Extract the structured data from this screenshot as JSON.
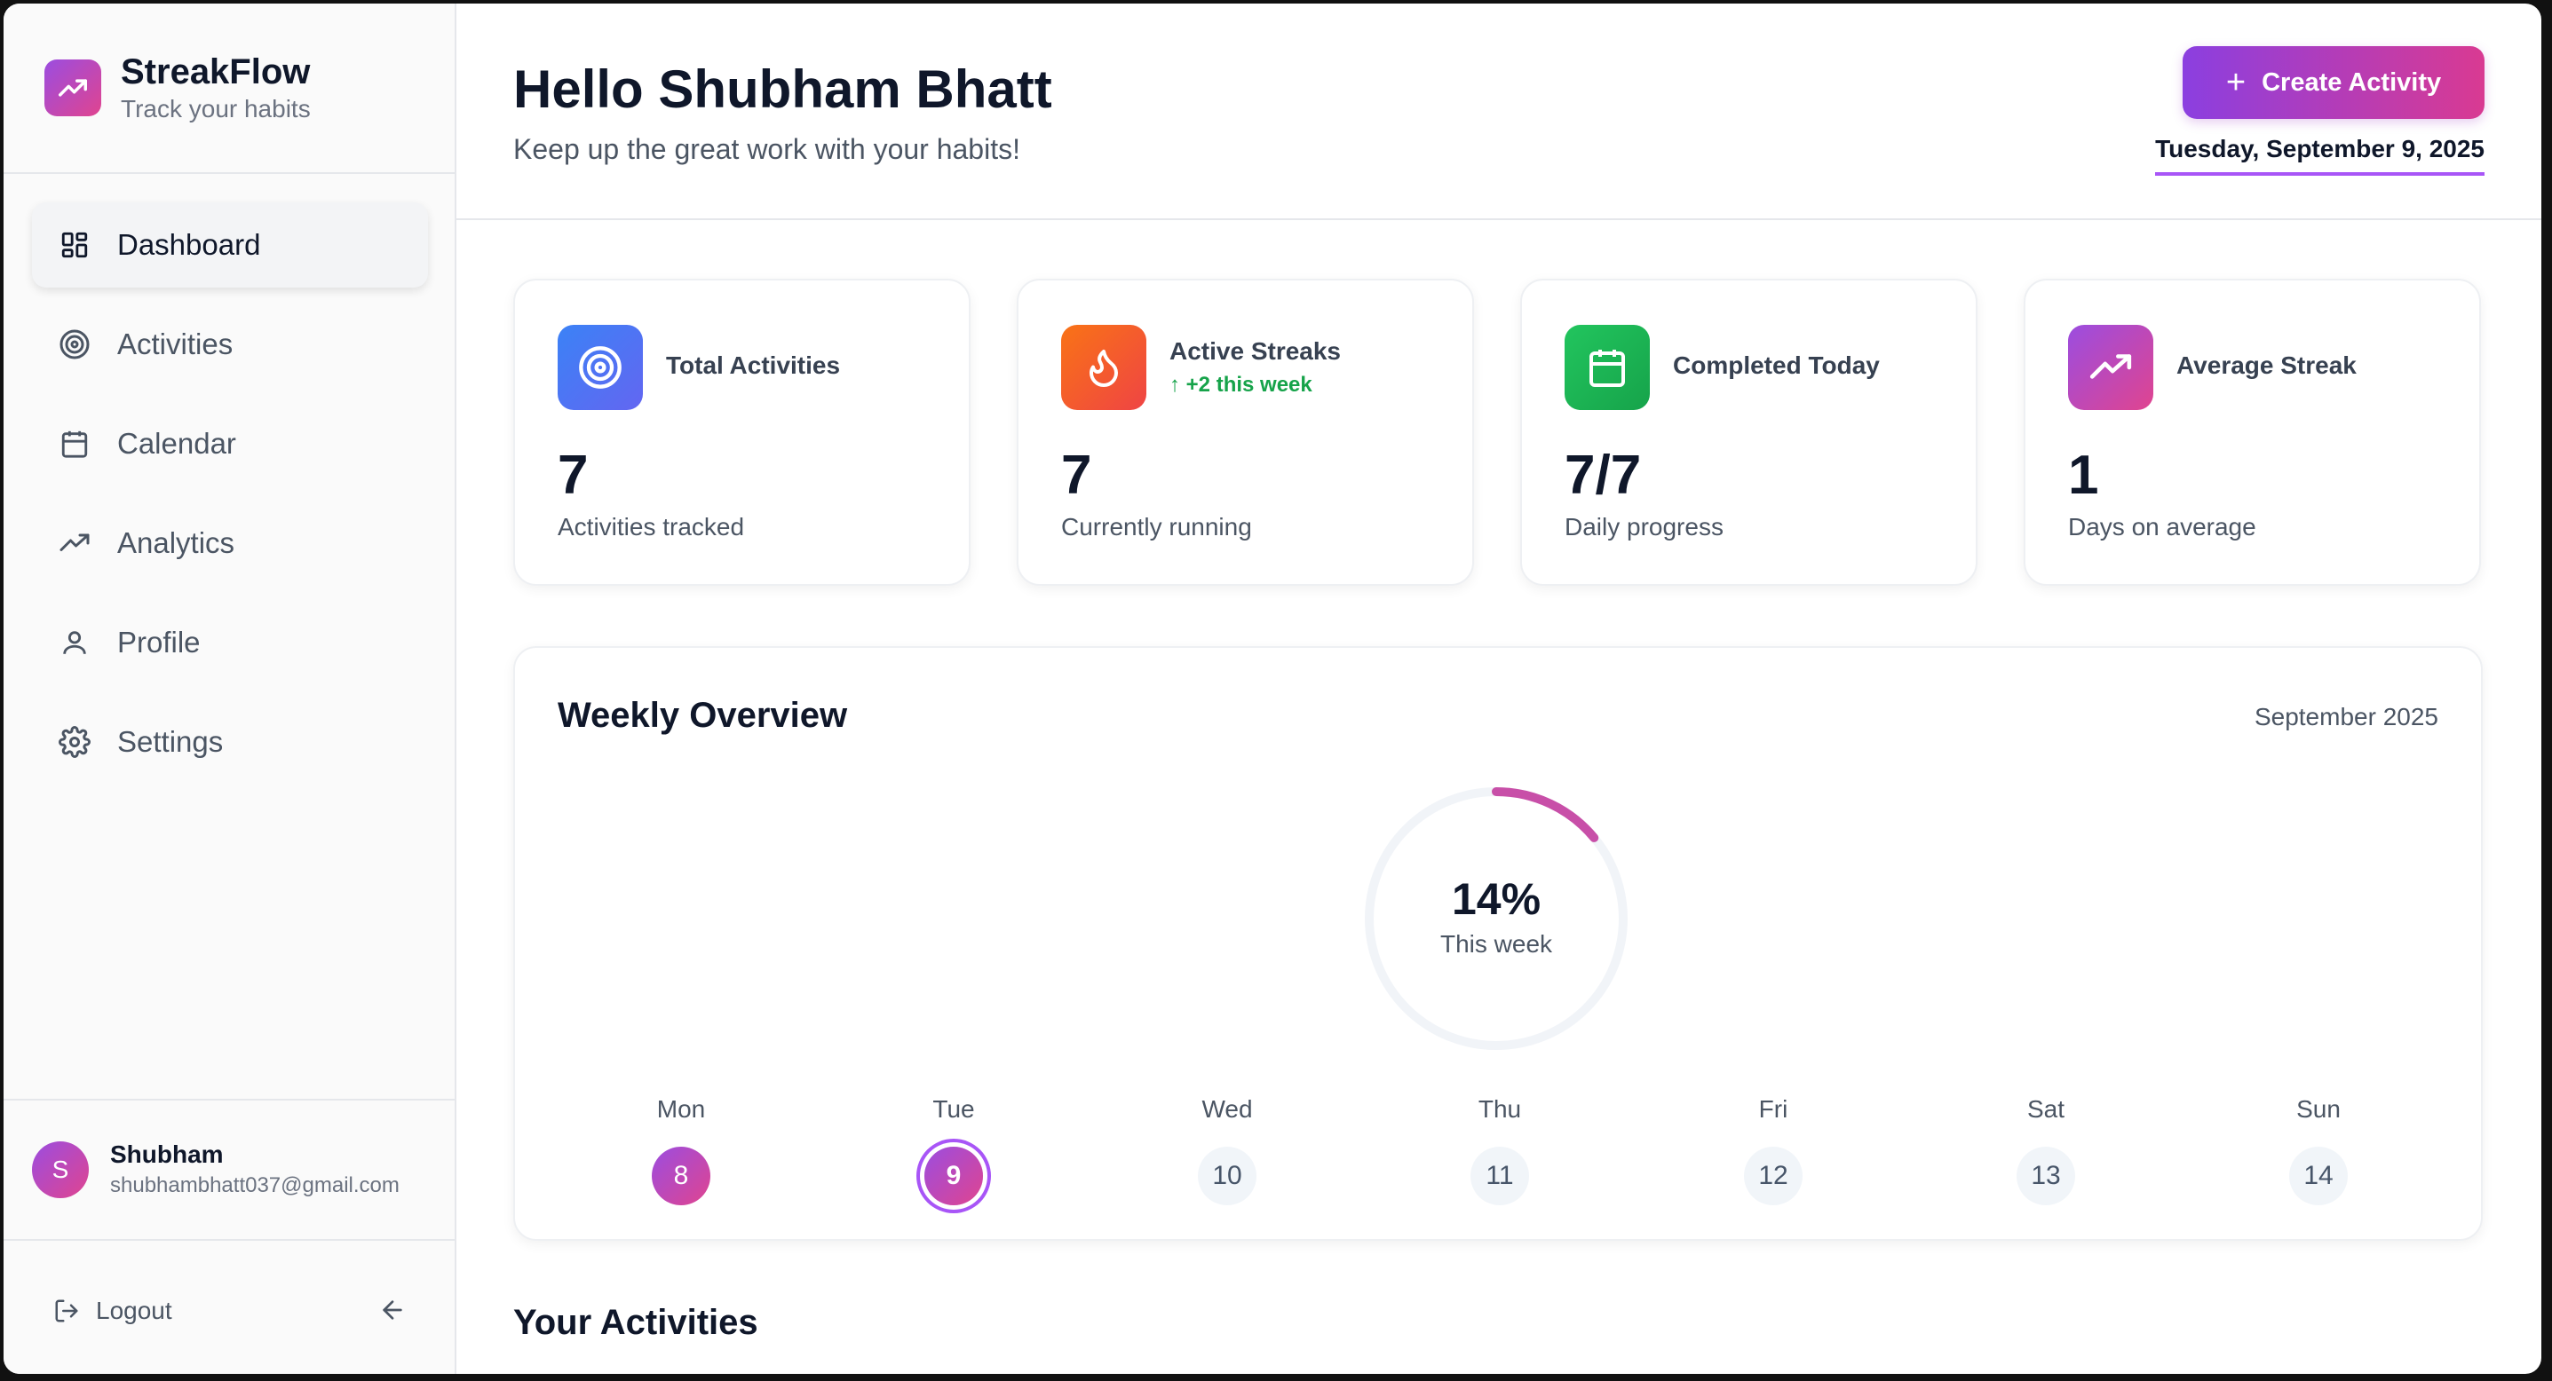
{
  "brand": {
    "title": "StreakFlow",
    "subtitle": "Track your habits"
  },
  "nav": {
    "items": [
      {
        "label": "Dashboard",
        "icon": "dashboard-icon",
        "active": true
      },
      {
        "label": "Activities",
        "icon": "target-icon"
      },
      {
        "label": "Calendar",
        "icon": "calendar-icon"
      },
      {
        "label": "Analytics",
        "icon": "trending-up-icon"
      },
      {
        "label": "Profile",
        "icon": "user-icon"
      },
      {
        "label": "Settings",
        "icon": "gear-icon"
      }
    ]
  },
  "user": {
    "initial": "S",
    "name": "Shubham",
    "email": "shubhambhatt037@gmail.com"
  },
  "logout": {
    "label": "Logout"
  },
  "header": {
    "greeting": "Hello Shubham Bhatt",
    "subtitle": "Keep up the great work with your habits!",
    "create_label": "Create Activity",
    "date": "Tuesday, September 9, 2025"
  },
  "stats": [
    {
      "title": "Total Activities",
      "value": "7",
      "desc": "Activities tracked",
      "icon": "target-icon",
      "color": "#3b82f6"
    },
    {
      "title": "Active Streaks",
      "trend": "↑ +2 this week",
      "value": "7",
      "desc": "Currently running",
      "icon": "flame-icon",
      "color": "#f97316"
    },
    {
      "title": "Completed Today",
      "value": "7/7",
      "desc": "Daily progress",
      "icon": "calendar-icon",
      "color": "#22c55e"
    },
    {
      "title": "Average Streak",
      "value": "1",
      "desc": "Days on average",
      "icon": "trending-up-icon",
      "color": "#a855f7"
    }
  ],
  "weekly": {
    "title": "Weekly Overview",
    "month": "September 2025",
    "percent_label": "14%",
    "percent_value": 14,
    "caption": "This week",
    "days": [
      {
        "name": "Mon",
        "num": "8",
        "state": "done"
      },
      {
        "name": "Tue",
        "num": "9",
        "state": "today"
      },
      {
        "name": "Wed",
        "num": "10",
        "state": ""
      },
      {
        "name": "Thu",
        "num": "11",
        "state": ""
      },
      {
        "name": "Fri",
        "num": "12",
        "state": ""
      },
      {
        "name": "Sat",
        "num": "13",
        "state": ""
      },
      {
        "name": "Sun",
        "num": "14",
        "state": ""
      }
    ]
  },
  "activities": {
    "title": "Your Activities"
  },
  "colors": {
    "accent_start": "#8b3fe0",
    "accent_end": "#d93a92"
  }
}
